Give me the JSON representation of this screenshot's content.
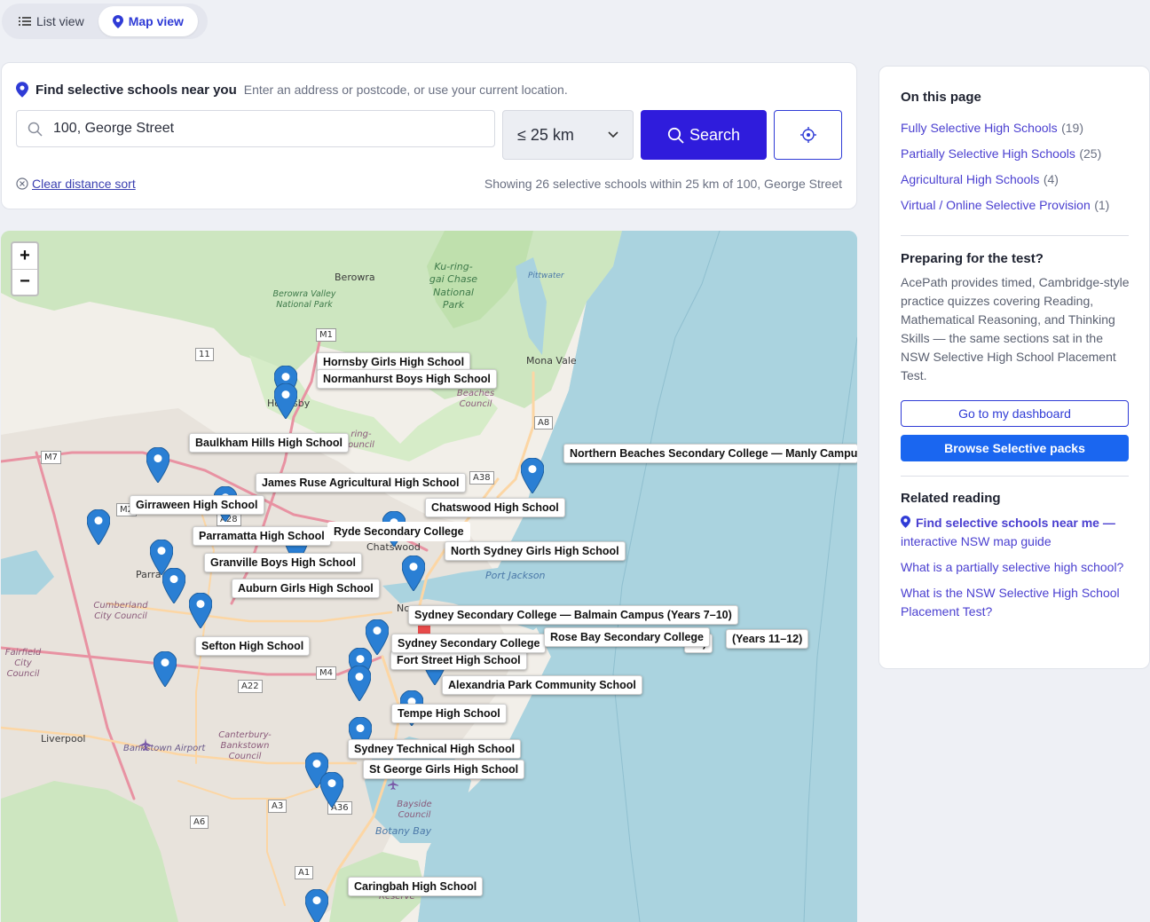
{
  "view_toggle": {
    "list_label": "List view",
    "map_label": "Map view",
    "active": "map"
  },
  "search": {
    "title": "Find selective schools near you",
    "subtitle": "Enter an address or postcode, or use your current location.",
    "address_value": "100, George Street",
    "distance": "≤ 25 km",
    "search_label": "Search",
    "clear_label": "Clear distance sort",
    "status": "Showing 26 selective schools within 25 km of 100, George Street"
  },
  "map": {
    "zoom_in": "+",
    "zoom_out": "−",
    "place_labels": [
      "Berowra",
      "Mona Vale",
      "Chatswood",
      "Liverpool",
      "Bankstown Airport",
      "Botany Bay",
      "Port Jackson",
      "Pittwater",
      "Parra",
      "Nc",
      "Ho",
      "sby"
    ],
    "park_labels": [
      "Berowra Valley National Park",
      "Ku-ring-gai Chase National Park"
    ],
    "council_labels": [
      "Beaches Council",
      "Cumberland City Council",
      "Fairfield City Council",
      "Canterbury-Bankstown Council",
      "Bayside Council",
      "ring-ouncil",
      "Reserve"
    ],
    "road_shields": [
      "M1",
      "11",
      "M7",
      "M2",
      "A28",
      "A38",
      "A8",
      "M4",
      "A22",
      "A3",
      "A36",
      "A6",
      "A1"
    ],
    "schools": [
      "Hornsby Girls High School",
      "Normanhurst Boys High School",
      "Baulkham Hills High School",
      "Northern Beaches Secondary College — Manly Campu",
      "James Ruse Agricultural High School",
      "Chatswood High School",
      "Girraween High School",
      "Parramatta High School",
      "Ryde Secondary College",
      "North Sydney Girls High School",
      "Granville Boys High School",
      "Auburn Girls High School",
      "Sydney Secondary College — Balmain Campus (Years 7–10)",
      "Sefton High School",
      "Sydney Secondary College",
      "Rose Bay Secondary College",
      "10)",
      "(Years 11–12)",
      "Fort Street High School",
      "Alexandria Park Community School",
      "Tempe High School",
      "Sydney Technical High School",
      "St George Girls High School",
      "Caringbah High School"
    ]
  },
  "sidebar": {
    "toc_title": "On this page",
    "toc": [
      {
        "label": "Fully Selective High Schools",
        "count": "(19)"
      },
      {
        "label": "Partially Selective High Schools",
        "count": "(25)"
      },
      {
        "label": "Agricultural High Schools",
        "count": "(4)"
      },
      {
        "label": "Virtual / Online Selective Provision",
        "count": "(1)"
      }
    ],
    "prep_title": "Preparing for the test?",
    "prep_text": "AcePath provides timed, Cambridge-style practice quizzes covering Reading, Mathematical Reasoning, and Thinking Skills — the same sections sat in the NSW Selective High School Placement Test.",
    "dashboard_label": "Go to my dashboard",
    "browse_label": "Browse Selective packs",
    "related_title": "Related reading",
    "related": [
      {
        "bold": "Find selective schools near me —",
        "rest": "interactive NSW map guide"
      },
      {
        "text": "What is a partially selective high school?"
      },
      {
        "text": "What is the NSW Selective High School Placement Test?"
      }
    ]
  },
  "colors": {
    "accent": "#2f1cdc",
    "link": "#4a3fd0",
    "pin": "#2a7fd4",
    "water": "#aad3df",
    "park": "#cde6c0"
  }
}
